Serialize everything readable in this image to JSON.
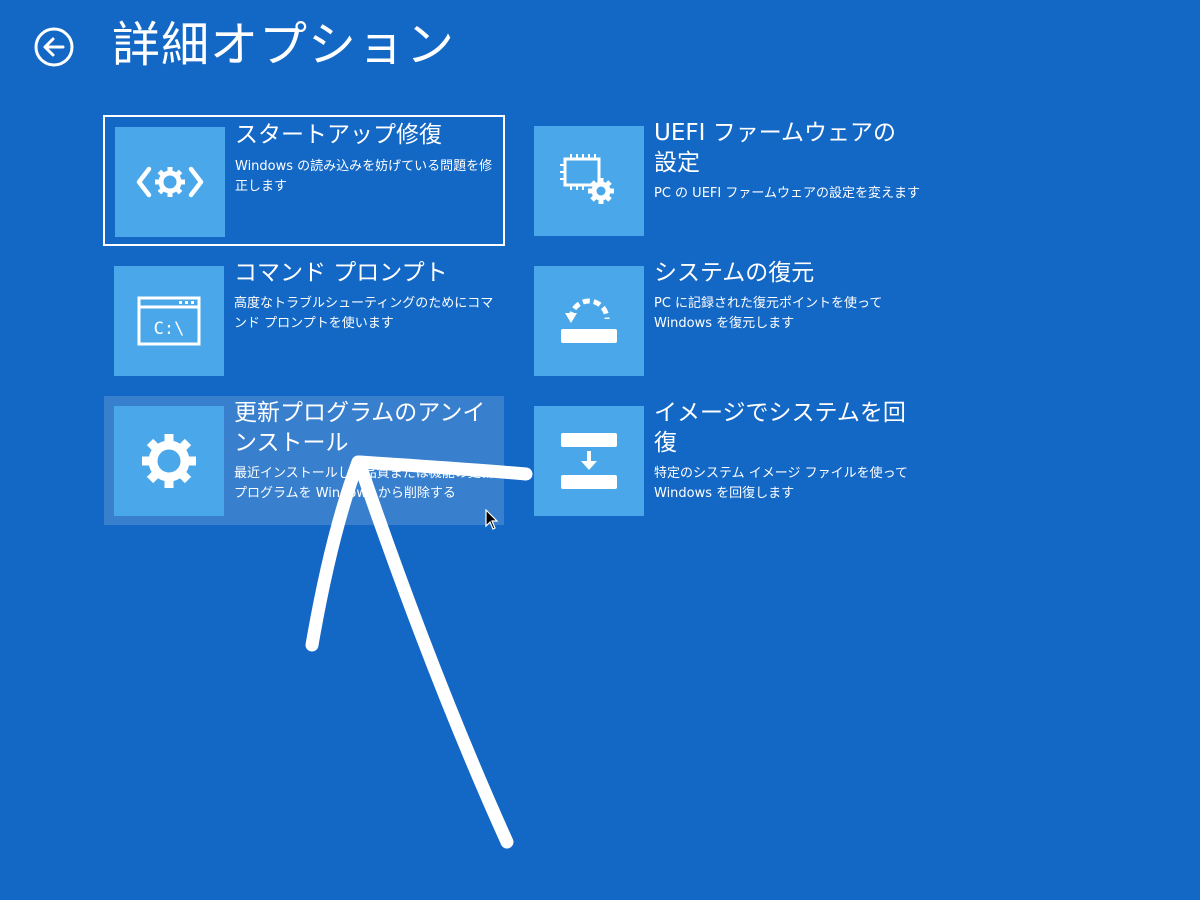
{
  "header": {
    "title": "詳細オプション",
    "back_icon": "arrow-left-circle-icon"
  },
  "tiles": [
    {
      "title": "スタートアップ修復",
      "description": "Windows の読み込みを妨げている問題を修正します",
      "icon": "startup-repair-icon",
      "state": "focused"
    },
    {
      "title": "UEFI ファームウェアの設定",
      "description": "PC の UEFI ファームウェアの設定を変えます",
      "icon": "firmware-settings-icon",
      "state": "normal"
    },
    {
      "title": "コマンド プロンプト",
      "description": "高度なトラブルシューティングのためにコマンド プロンプトを使います",
      "icon": "command-prompt-icon",
      "icon_text": "C:\\",
      "state": "normal"
    },
    {
      "title": "システムの復元",
      "description": "PC に記録された復元ポイントを使って Windows を復元します",
      "icon": "system-restore-icon",
      "state": "normal"
    },
    {
      "title": "更新プログラムのアンインストール",
      "description": "最近インストールした品質または機能の更新プログラムを Windows から削除する",
      "icon": "gear-icon",
      "state": "hovered"
    },
    {
      "title": "イメージでシステムを回復",
      "description": "特定のシステム イメージ ファイルを使って Windows を回復します",
      "icon": "system-image-recovery-icon",
      "state": "normal"
    }
  ],
  "colors": {
    "background": "#1367c5",
    "tile_icon_bg": "#4aa7ea",
    "text": "#ffffff"
  }
}
